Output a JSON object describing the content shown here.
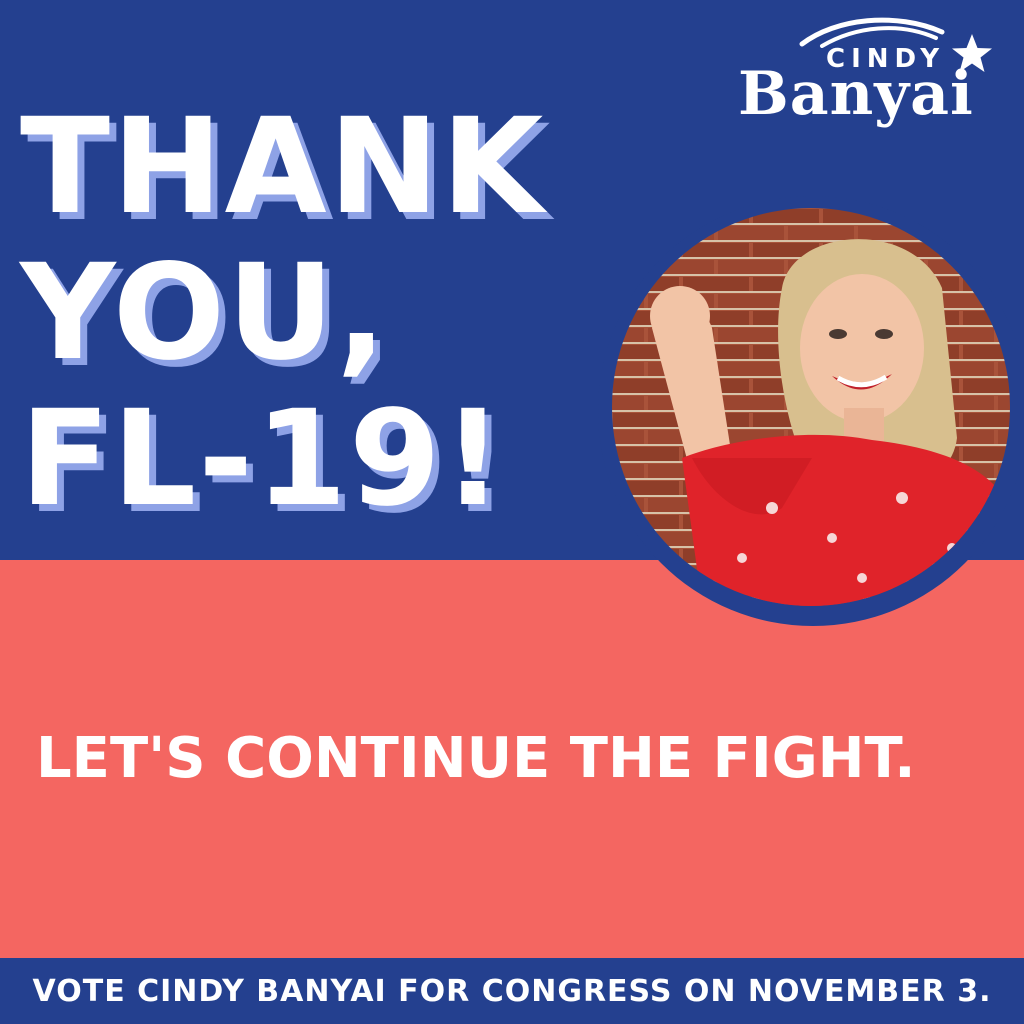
{
  "headline": {
    "line1": "THANK",
    "line2": "YOU,",
    "line3": "FL-19!"
  },
  "logo": {
    "top_text": "CINDY",
    "bottom_text": "Banyai"
  },
  "tagline": "LET'S CONTINUE THE FIGHT.",
  "footer": {
    "text": "VOTE CINDY BANYAI FOR CONGRESS ON NOVEMBER 3."
  },
  "colors": {
    "navy": "#24408f",
    "coral": "#f46661",
    "shadow_blue": "#8ea2e6",
    "white": "#ffffff"
  },
  "icons": {
    "logo_mark": "star-with-swoosh-icon"
  }
}
